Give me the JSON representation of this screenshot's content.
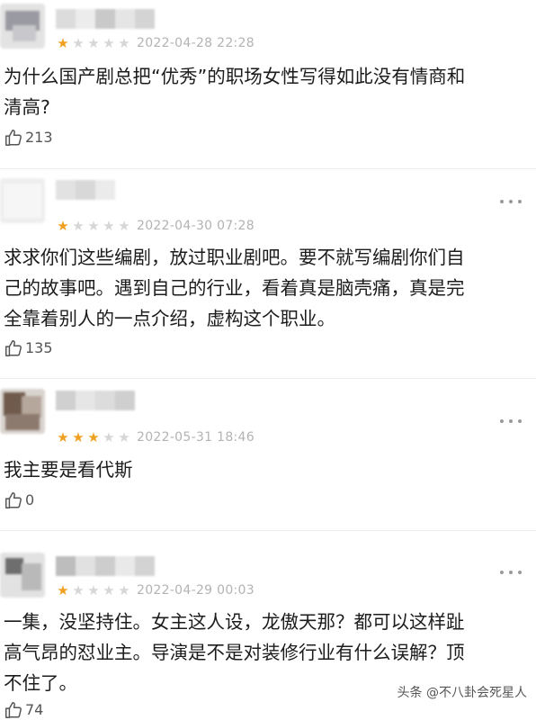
{
  "reviews": [
    {
      "rating": 1,
      "stars": [
        "★",
        "★",
        "★",
        "★",
        "★"
      ],
      "date": "2022-04-28 22:28",
      "content": "为什么国产剧总把“优秀”的职场女性写得如此没有情商和\n清高?",
      "likes": "213"
    },
    {
      "rating": 1,
      "stars": [
        "★",
        "★",
        "★",
        "★",
        "★"
      ],
      "date": "2022-04-30 07:28",
      "content": "求求你们这些编剧，放过职业剧吧。要不就写编剧你们自\n己的故事吧。遇到自己的行业，看着真是脑壳痛，真是完\n全靠着别人的一点介绍，虚构这个职业。",
      "likes": "135"
    },
    {
      "rating": 3,
      "stars": [
        "★",
        "★",
        "★",
        "★",
        "★"
      ],
      "date": "2022-05-31 18:46",
      "content": "我主要是看代斯",
      "likes": "0"
    },
    {
      "rating": 1,
      "stars": [
        "★",
        "★",
        "★",
        "★",
        "★"
      ],
      "date": "2022-04-29 00:03",
      "content": "一集，没坚持住。女主这人设，龙傲天那？都可以这样趾\n高气昂的怼业主。导演是不是对装修行业有什么误解？顶\n不住了。",
      "likes": "74"
    }
  ],
  "icons": {
    "star": "star-icon",
    "like": "thumbs-up-icon",
    "more": "more-dots-icon"
  },
  "colors": {
    "star_on": "#f0a020",
    "star_off": "#d6d6d6",
    "date": "#b3b3b3"
  },
  "watermark": "头条 @不八卦会死星人"
}
